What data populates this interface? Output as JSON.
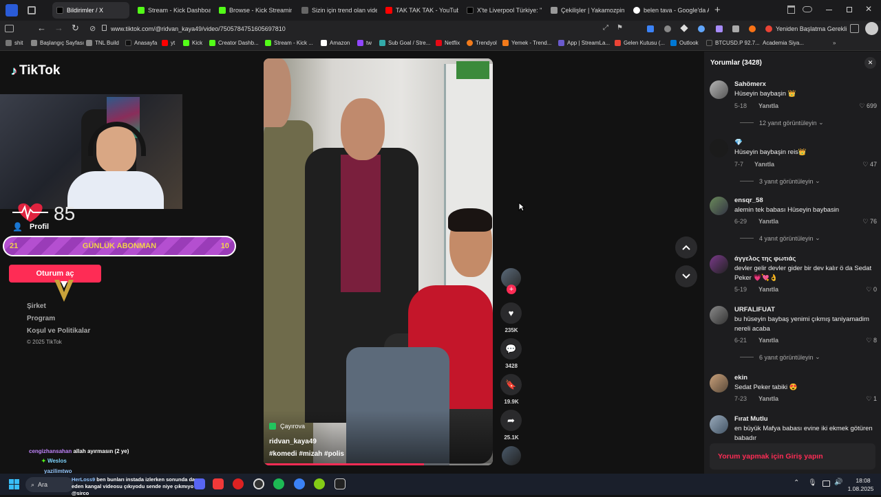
{
  "tabs": [
    {
      "label": "Bildirimler / X",
      "color": "#222"
    },
    {
      "label": "Stream - Kick Dashboard",
      "color": "#53fc18"
    },
    {
      "label": "Browse - Kick Streaming",
      "color": "#53fc18"
    },
    {
      "label": "Sizin için trend olan videola",
      "color": "#555"
    },
    {
      "label": "TAK TAK TAK - YouTube",
      "color": "#ff0000"
    },
    {
      "label": "X'te Liverpool Türkiye: \"",
      "color": "#222"
    },
    {
      "label": "Çekilişler | Yakamozpin",
      "color": "#888"
    },
    {
      "label": "belen tava - Google'da Ara",
      "color": "#4285f4"
    }
  ],
  "address": {
    "url": "www.tiktok.com/@ridvan_kaya49/video/7505784751605697810",
    "restart_label": "Yeniden Başlatma Gerekli"
  },
  "bookmarks": [
    {
      "label": "shit",
      "color": "#777"
    },
    {
      "label": "Başlangıç Sayfası",
      "color": "#888"
    },
    {
      "label": "TNL Build",
      "color": "#888"
    },
    {
      "label": "Anasayfa",
      "color": "#222"
    },
    {
      "label": "yt",
      "color": "#ff0000"
    },
    {
      "label": "Kick",
      "color": "#53fc18"
    },
    {
      "label": "Creator Dashb...",
      "color": "#53fc18"
    },
    {
      "label": "Stream - Kick ...",
      "color": "#53fc18"
    },
    {
      "label": "Amazon",
      "color": "#fff"
    },
    {
      "label": "tw",
      "color": "#9146ff"
    },
    {
      "label": "Sub Goal / Stre...",
      "color": "#3aa"
    },
    {
      "label": "Netflix",
      "color": "#e50914"
    },
    {
      "label": "Trendyol",
      "color": "#f27a1a"
    },
    {
      "label": "Yemek - Trend...",
      "color": "#f27a1a"
    },
    {
      "label": "App | StreamLa...",
      "color": "#6a5acd"
    },
    {
      "label": "Gelen Kutusu (...",
      "color": "#ea4335"
    },
    {
      "label": "Outlook",
      "color": "#0078d4"
    },
    {
      "label": "BTCUSD.P 92.7...",
      "color": "#222"
    },
    {
      "label": "Academia Siya...",
      "color": "#555"
    }
  ],
  "tiktok": {
    "logo": "TikTok",
    "profile": "Profil",
    "login_button": "Oturum aç",
    "footer": [
      "Şirket",
      "Program",
      "Koşul ve Politikalar"
    ],
    "copyright": "© 2025 TikTok"
  },
  "overlay": {
    "heart_count": "85",
    "sub_goal_left": "21",
    "sub_goal_label": "GÜNLÜK ABONMAN",
    "sub_goal_right": "10",
    "chat": [
      {
        "user": "cengizhansahan",
        "msg": "allah ayırmasın (2 ye)"
      },
      {
        "user": "Weslos",
        "msg": ""
      },
      {
        "user": "yazilimtwo",
        "msg": ""
      }
    ],
    "ticker_user": "HerLoss9",
    "ticker_msg": "ben bunları instada izlerken sonunda dans eden kangal videosu çıkıyodu sende niye çıkmıyo @sirco"
  },
  "video": {
    "location": "Çayırova",
    "author": "ridvan_kaya49",
    "tags": "#komedi #mizah #polis",
    "likes": "235K",
    "comments": "3428",
    "saves": "19.9K",
    "shares": "25.1K"
  },
  "comments_panel": {
    "title": "Yorumlar (3428)",
    "login_prompt": "Yorum yapmak için Giriş yapın",
    "reply_label": "Yanıtla",
    "items": [
      {
        "name": "Sahömerx",
        "text": "Hüseyin baybaşin 👑",
        "date": "5-18",
        "likes": "699",
        "replies": "12 yanıt görüntüleyin"
      },
      {
        "name": "💎",
        "text": "Hüseyin baybaşin reis👑",
        "date": "7-7",
        "likes": "47",
        "replies": "3 yanıt görüntüleyin"
      },
      {
        "name": "ensqr_58",
        "text": "alemin tek babası Hüseyin baybasin",
        "date": "6-29",
        "likes": "76",
        "replies": "4 yanıt görüntüleyin"
      },
      {
        "name": "άγγελος της φωτιάς",
        "text": "devler gelir devler gider bir dev kalır ö da Sedat Peker 💗💘👌",
        "date": "5-19",
        "likes": "0",
        "replies": ""
      },
      {
        "name": "URFALIFUAT",
        "text": "bu hüseyin baybaş yenimi çıkmış taniyamadim nereli acaba",
        "date": "6-21",
        "likes": "8",
        "replies": "6 yanıt görüntüleyin"
      },
      {
        "name": "ekin",
        "text": "Sedat Peker tabiki 😍",
        "date": "7-23",
        "likes": "1",
        "replies": ""
      },
      {
        "name": "Fırat Mutlu",
        "text": "en büyük Mafya babası evine iki ekmek götüren babadır",
        "date": "",
        "likes": "",
        "replies": ""
      }
    ]
  },
  "taskbar": {
    "search": "Ara",
    "time": "18:08",
    "date": "1.08.2025"
  }
}
